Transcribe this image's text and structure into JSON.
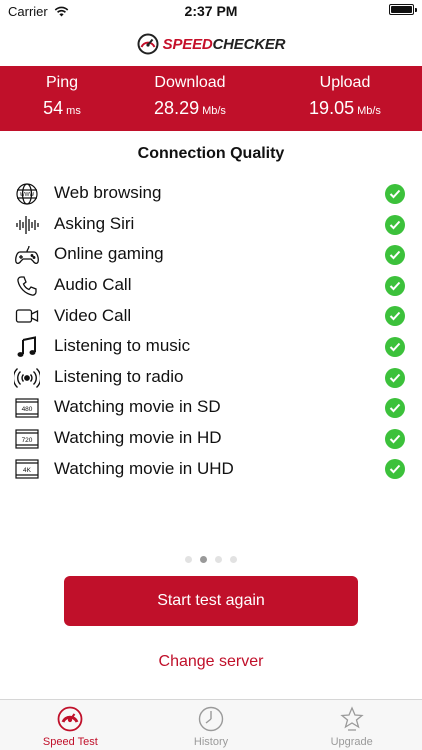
{
  "status_bar": {
    "carrier": "Carrier",
    "time": "2:37 PM"
  },
  "logo": {
    "speed": "SPEED",
    "checker": "CHECKER"
  },
  "stats": {
    "ping": {
      "label": "Ping",
      "value": "54",
      "unit": "ms"
    },
    "download": {
      "label": "Download",
      "value": "28.29",
      "unit": "Mb/s"
    },
    "upload": {
      "label": "Upload",
      "value": "19.05",
      "unit": "Mb/s"
    }
  },
  "quality": {
    "title": "Connection Quality",
    "items": [
      {
        "label": "Web browsing",
        "icon": "globe-icon"
      },
      {
        "label": "Asking Siri",
        "icon": "soundwave-icon"
      },
      {
        "label": "Online gaming",
        "icon": "gamepad-icon"
      },
      {
        "label": "Audio Call",
        "icon": "phone-icon"
      },
      {
        "label": "Video Call",
        "icon": "video-camera-icon"
      },
      {
        "label": "Listening to music",
        "icon": "music-note-icon"
      },
      {
        "label": "Listening to radio",
        "icon": "radio-signal-icon"
      },
      {
        "label": "Watching movie in SD",
        "icon": "film-480-icon",
        "badge": "480"
      },
      {
        "label": "Watching movie in HD",
        "icon": "film-720-icon",
        "badge": "720"
      },
      {
        "label": "Watching movie in UHD",
        "icon": "film-4k-icon",
        "badge": "4K"
      }
    ]
  },
  "pager": {
    "count": 4,
    "active": 1
  },
  "actions": {
    "start_label": "Start test again",
    "change_server_label": "Change server"
  },
  "tabs": [
    {
      "label": "Speed Test"
    },
    {
      "label": "History"
    },
    {
      "label": "Upgrade"
    }
  ],
  "colors": {
    "brand": "#c0102a",
    "check": "#3cc13b"
  }
}
